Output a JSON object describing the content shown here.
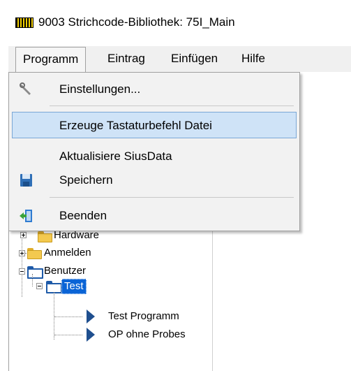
{
  "window": {
    "title": "9003 Strichcode-Bibliothek: 75I_Main",
    "icon": "barcode-icon"
  },
  "menubar": {
    "items": [
      {
        "label": "Programm"
      },
      {
        "label": "Eintrag"
      },
      {
        "label": "Einfügen"
      },
      {
        "label": "Hilfe"
      }
    ]
  },
  "dropdown": {
    "items": [
      {
        "label": "Einstellungen...",
        "icon": "wrench-icon"
      },
      {
        "label": "Erzeuge Tastaturbefehl Datei",
        "icon": "",
        "highlighted": true
      },
      {
        "label": "Aktualisiere SiusData",
        "icon": ""
      },
      {
        "label": "Speichern",
        "icon": "floppy-disk-icon"
      },
      {
        "label": "Beenden",
        "icon": "exit-door-icon"
      }
    ]
  },
  "tree": {
    "hidden_label": "Hardware",
    "anmelden": "Anmelden",
    "benutzer": "Benutzer",
    "test": "Test",
    "children": [
      {
        "label": "Test Programm",
        "icon": "program-arrow-icon"
      },
      {
        "label": "OP ohne Probes",
        "icon": "program-arrow-icon"
      }
    ]
  },
  "colors": {
    "selection": "#0a64d6",
    "highlight": "#cfe3f7",
    "folder": "#f3c94f"
  }
}
